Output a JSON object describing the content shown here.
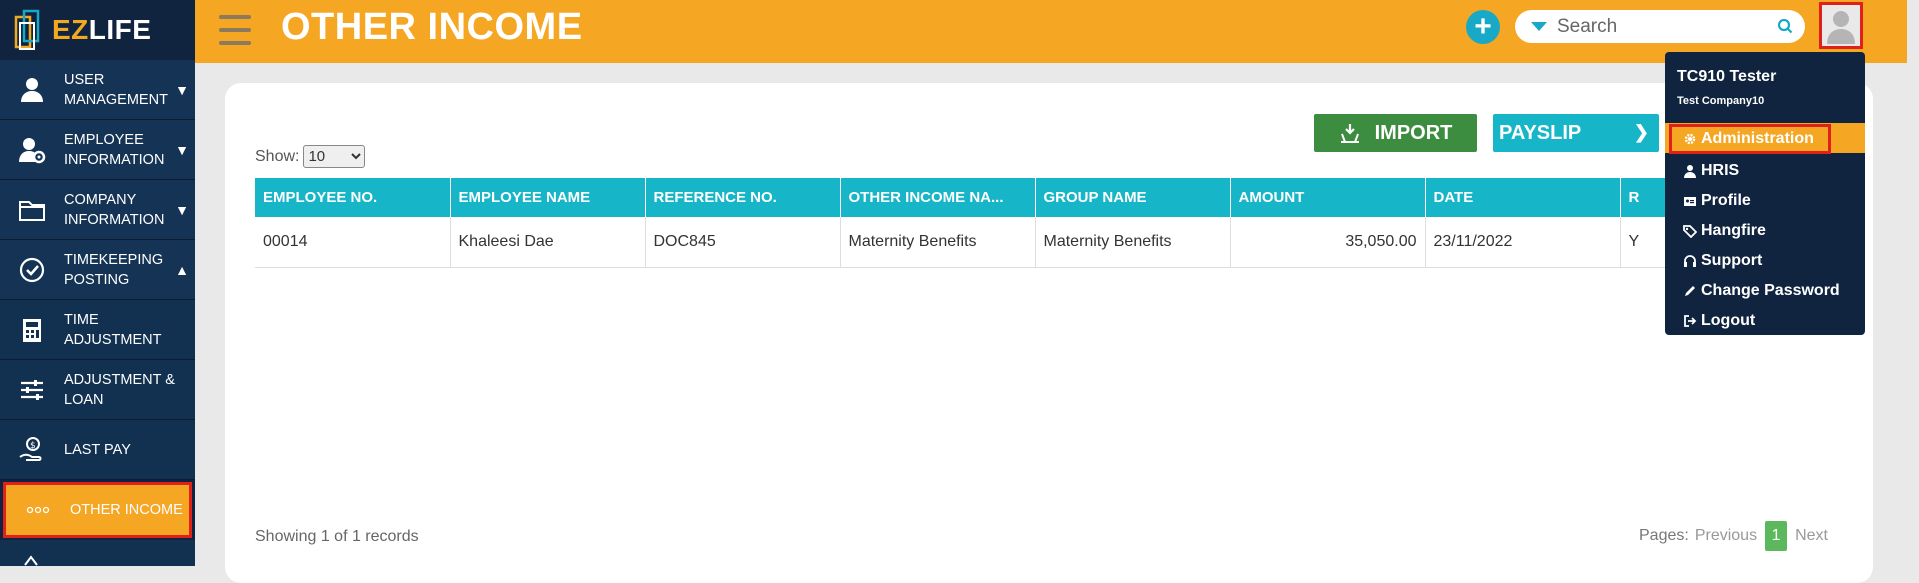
{
  "app": {
    "logo_text_a": "EZ",
    "logo_text_b": "LIFE",
    "page_title": "OTHER INCOME"
  },
  "sidebar": {
    "items": [
      {
        "label": "USER\nMANAGEMENT",
        "icon": "user-icon",
        "caret": "down"
      },
      {
        "label": "EMPLOYEE\nINFORMATION",
        "icon": "user-gear-icon",
        "caret": "down"
      },
      {
        "label": "COMPANY\nINFORMATION",
        "icon": "folder-icon",
        "caret": "down"
      },
      {
        "label": "TIMEKEEPING\nPOSTING",
        "icon": "check-circle-icon",
        "caret": "up"
      },
      {
        "label": "TIME\nADJUSTMENT",
        "icon": "calculator-icon"
      },
      {
        "label": "ADJUSTMENT &\nLOAN",
        "icon": "sliders-icon"
      },
      {
        "label": "LAST PAY",
        "icon": "hand-money-icon"
      },
      {
        "label": "OTHER INCOME",
        "icon": "dots-icon",
        "active": true
      }
    ]
  },
  "header": {
    "search_placeholder": "Search",
    "add_icon": "plus-circle-icon"
  },
  "toolbar": {
    "import_label": "IMPORT",
    "payslip_label": "PAYSLIP",
    "show_label": "Show:",
    "show_value": "10",
    "show_options": [
      "10"
    ]
  },
  "table": {
    "columns": [
      "EMPLOYEE NO.",
      "EMPLOYEE NAME",
      "REFERENCE NO.",
      "OTHER INCOME NA...",
      "GROUP NAME",
      "AMOUNT",
      "DATE",
      "R"
    ],
    "rows": [
      [
        "00014",
        "Khaleesi Dae",
        "DOC845",
        "Maternity Benefits",
        "Maternity Benefits",
        "35,050.00",
        "23/11/2022",
        "Y"
      ]
    ]
  },
  "footer": {
    "showing": "Showing 1 of 1 records",
    "pages_label": "Pages:",
    "previous": "Previous",
    "current_page": "1",
    "next": "Next"
  },
  "user_menu": {
    "name": "TC910 Tester",
    "company": "Test Company10",
    "items": [
      {
        "label": "Administration",
        "icon": "gear-icon",
        "highlighted": true
      },
      {
        "label": "HRIS",
        "icon": "user-icon"
      },
      {
        "label": "Profile",
        "icon": "id-card-icon"
      },
      {
        "label": "Hangfire",
        "icon": "tags-icon"
      },
      {
        "label": "Support",
        "icon": "headset-icon"
      },
      {
        "label": "Change Password",
        "icon": "pencil-icon"
      },
      {
        "label": "Logout",
        "icon": "logout-icon"
      }
    ]
  },
  "colors": {
    "brand_orange": "#f5a623",
    "sidebar_navy": "#10243f",
    "table_header": "#17b5c8",
    "import_green": "#3c8d3f",
    "highlight_red": "#e0201b"
  }
}
